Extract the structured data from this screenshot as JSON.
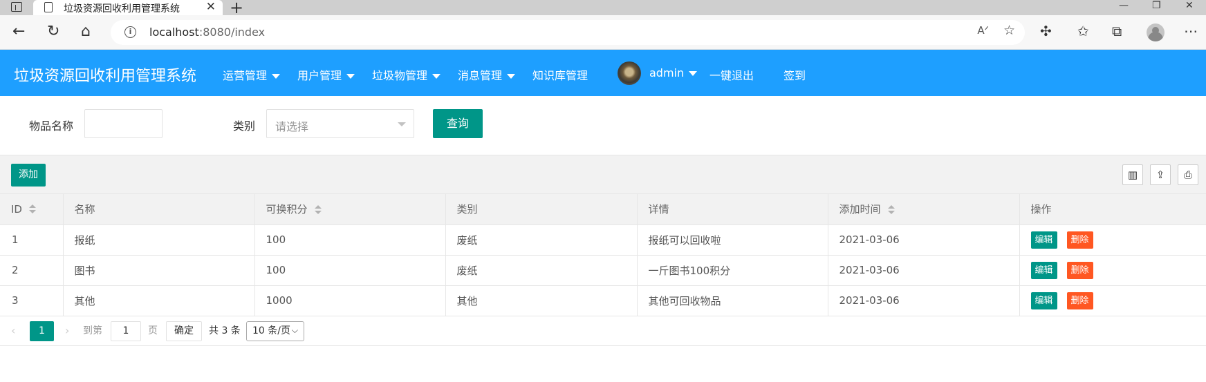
{
  "browser": {
    "tab_title": "垃圾资源回收利用管理系统",
    "url_host": "localhost",
    "url_rest": ":8080/index",
    "window_controls": [
      "minimize-icon",
      "restore-icon",
      "close-icon"
    ]
  },
  "header": {
    "app_title": "垃圾资源回收利用管理系统",
    "menu": [
      {
        "label": "运营管理",
        "dropdown": true
      },
      {
        "label": "用户管理",
        "dropdown": true
      },
      {
        "label": "垃圾物管理",
        "dropdown": true
      },
      {
        "label": "消息管理",
        "dropdown": true
      },
      {
        "label": "知识库管理",
        "dropdown": false
      }
    ],
    "user": "admin",
    "logout": "一键退出",
    "signin": "签到",
    "accent_color": "#1e9fff"
  },
  "search": {
    "name_label": "物品名称",
    "name_value": "",
    "category_label": "类别",
    "category_placeholder": "请选择",
    "query_button": "查询"
  },
  "toolbar": {
    "add_button": "添加",
    "tools": [
      "columns-filter-icon",
      "export-icon",
      "print-icon"
    ]
  },
  "table": {
    "columns": [
      {
        "label": "ID",
        "sortable": true
      },
      {
        "label": "名称",
        "sortable": false
      },
      {
        "label": "可换积分",
        "sortable": true
      },
      {
        "label": "类别",
        "sortable": false
      },
      {
        "label": "详情",
        "sortable": false
      },
      {
        "label": "添加时间",
        "sortable": true
      },
      {
        "label": "操作",
        "sortable": false
      }
    ],
    "rows": [
      {
        "id": "1",
        "name": "报纸",
        "points": "100",
        "category": "废纸",
        "detail": "报纸可以回收啦",
        "date": "2021-03-06"
      },
      {
        "id": "2",
        "name": "图书",
        "points": "100",
        "category": "废纸",
        "detail": "一斤图书100积分",
        "date": "2021-03-06"
      },
      {
        "id": "3",
        "name": "其他",
        "points": "1000",
        "category": "其他",
        "detail": "其他可回收物品",
        "date": "2021-03-06"
      }
    ],
    "edit_label": "编辑",
    "delete_label": "删除"
  },
  "pagination": {
    "current_page": "1",
    "goto_label": "到第",
    "goto_value": "1",
    "page_unit": "页",
    "confirm": "确定",
    "total": "共 3 条",
    "page_size": "10 条/页"
  }
}
